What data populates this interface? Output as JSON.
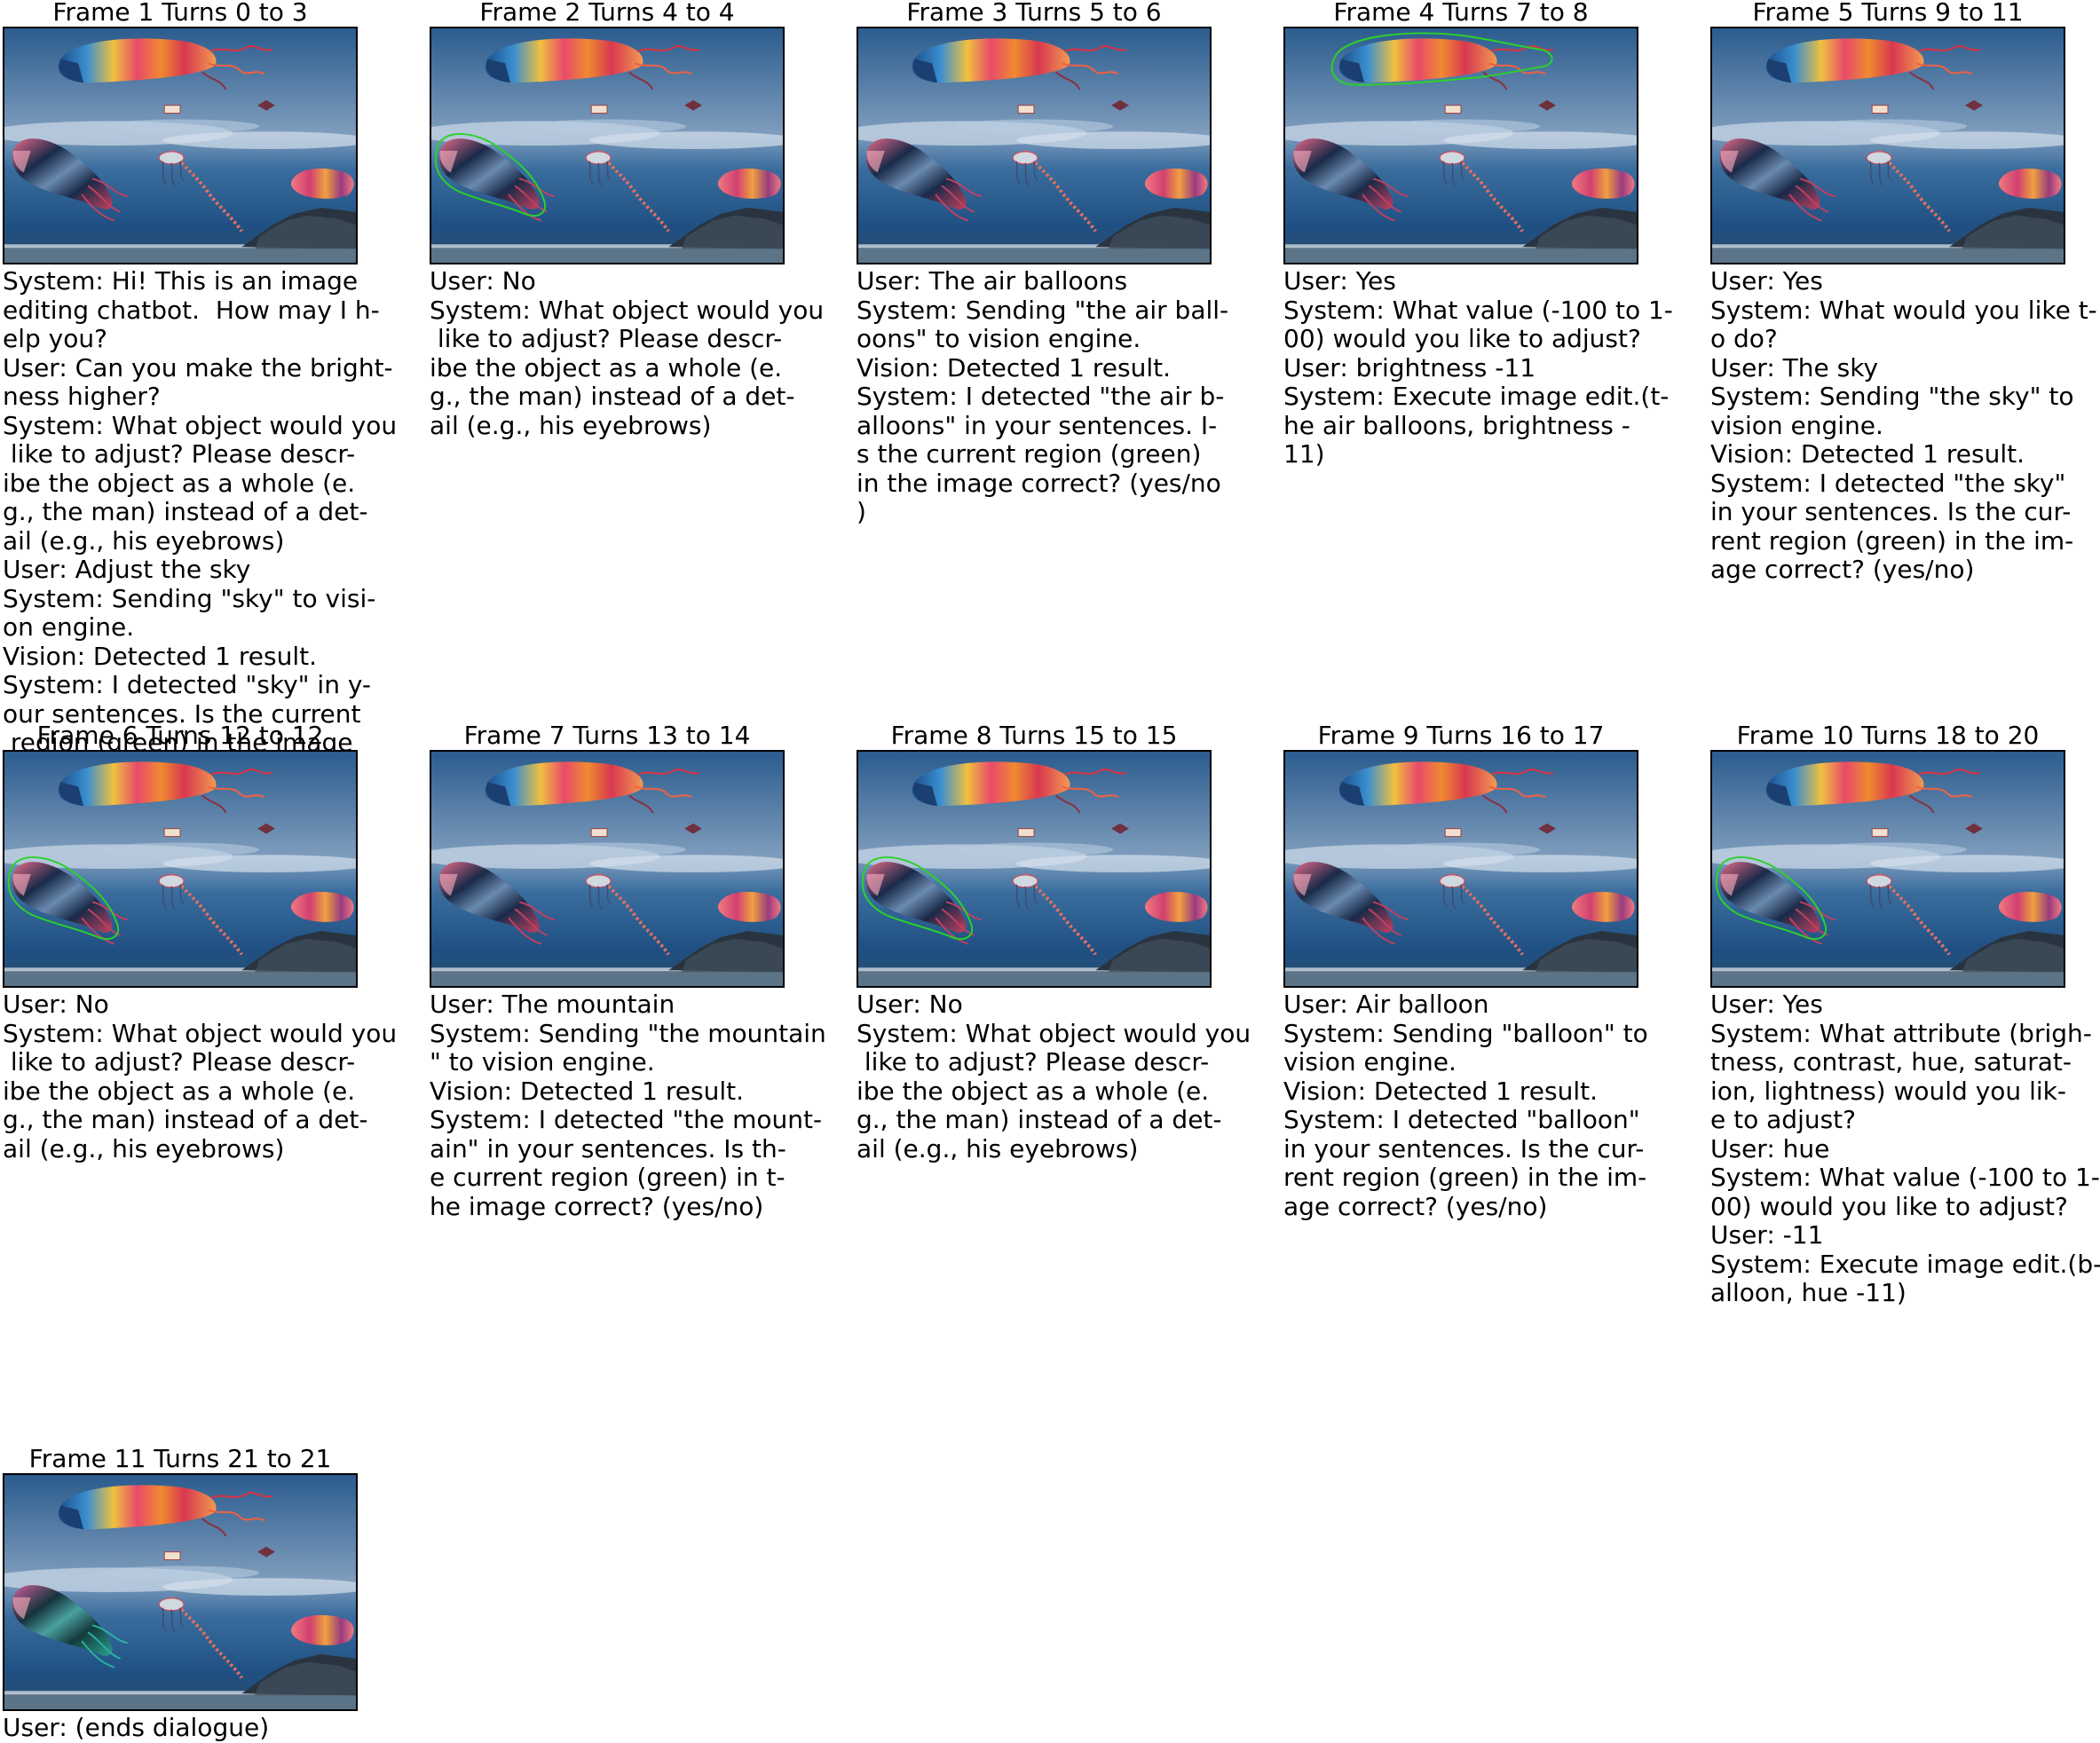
{
  "colors": {
    "region_outline": "#2bd12b",
    "text": "#000000",
    "background": "#ffffff"
  },
  "frames": [
    {
      "title": "Frame 1 Turns 0 to 3",
      "highlight": "none",
      "lines": [
        "System: Hi! This is an image",
        "editing chatbot.  How may I h-",
        "elp you?",
        "User: Can you make the bright-",
        "ness higher?",
        "System: What object would you",
        " like to adjust? Please descr-",
        "ibe the object as a whole (e.",
        "g., the man) instead of a det-",
        "ail (e.g., his eyebrows)",
        "User: Adjust the sky",
        "System: Sending \"sky\" to visi-",
        "on engine.",
        "Vision: Detected 1 result.",
        "System: I detected \"sky\" in y-",
        "our sentences. Is the current",
        " region (green) in the image"
      ]
    },
    {
      "title": "Frame 2 Turns 4 to 4",
      "highlight": "lower-balloon",
      "lines": [
        "User: No",
        "System: What object would you",
        " like to adjust? Please descr-",
        "ibe the object as a whole (e.",
        "g., the man) instead of a det-",
        "ail (e.g., his eyebrows)"
      ]
    },
    {
      "title": "Frame 3 Turns 5 to 6",
      "highlight": "none",
      "lines": [
        "User: The air balloons",
        "System: Sending \"the air ball-",
        "oons\" to vision engine.",
        "Vision: Detected 1 result.",
        "System: I detected \"the air b-",
        "alloons\" in your sentences. I-",
        "s the current region (green)",
        "in the image correct? (yes/no",
        ")"
      ]
    },
    {
      "title": "Frame 4 Turns 7 to 8",
      "highlight": "upper-balloon",
      "lines": [
        "User: Yes",
        "System: What value (-100 to 1-",
        "00) would you like to adjust?",
        "User: brightness -11",
        "System: Execute image edit.(t-",
        "he air balloons, brightness -",
        "11)"
      ]
    },
    {
      "title": "Frame 5 Turns 9 to 11",
      "highlight": "none",
      "lines": [
        "User: Yes",
        "System: What would you like t-",
        "o do?",
        "User: The sky",
        "System: Sending \"the sky\" to",
        "vision engine.",
        "Vision: Detected 1 result.",
        "System: I detected \"the sky\"",
        "in your sentences. Is the cur-",
        "rent region (green) in the im-",
        "age correct? (yes/no)"
      ]
    },
    {
      "title": "Frame 6 Turns 12 to 12",
      "highlight": "lower-balloon",
      "lines": [
        "User: No",
        "System: What object would you",
        " like to adjust? Please descr-",
        "ibe the object as a whole (e.",
        "g., the man) instead of a det-",
        "ail (e.g., his eyebrows)"
      ]
    },
    {
      "title": "Frame 7 Turns 13 to 14",
      "highlight": "none",
      "lines": [
        "User: The mountain",
        "System: Sending \"the mountain",
        "\" to vision engine.",
        "Vision: Detected 1 result.",
        "System: I detected \"the mount-",
        "ain\" in your sentences. Is th-",
        "e current region (green) in t-",
        "he image correct? (yes/no)"
      ]
    },
    {
      "title": "Frame 8 Turns 15 to 15",
      "highlight": "lower-balloon",
      "lines": [
        "User: No",
        "System: What object would you",
        " like to adjust? Please descr-",
        "ibe the object as a whole (e.",
        "g., the man) instead of a det-",
        "ail (e.g., his eyebrows)"
      ]
    },
    {
      "title": "Frame 9 Turns 16 to 17",
      "highlight": "none",
      "lines": [
        "User: Air balloon",
        "System: Sending \"balloon\" to",
        "vision engine.",
        "Vision: Detected 1 result.",
        "System: I detected \"balloon\"",
        "in your sentences. Is the cur-",
        "rent region (green) in the im-",
        "age correct? (yes/no)"
      ]
    },
    {
      "title": "Frame 10 Turns 18 to 20",
      "highlight": "lower-balloon",
      "lines": [
        "User: Yes",
        "System: What attribute (brigh-",
        "tness, contrast, hue, saturat-",
        "ion, lightness) would you lik-",
        "e to adjust?",
        "User: hue",
        "System: What value (-100 to 1-",
        "00) would you like to adjust?",
        "User: -11",
        "System: Execute image edit.(b-",
        "alloon, hue -11)"
      ]
    },
    {
      "title": "Frame 11 Turns 21 to 21",
      "highlight": "hue-shift",
      "lines": [
        "User: (ends dialogue)"
      ]
    }
  ]
}
